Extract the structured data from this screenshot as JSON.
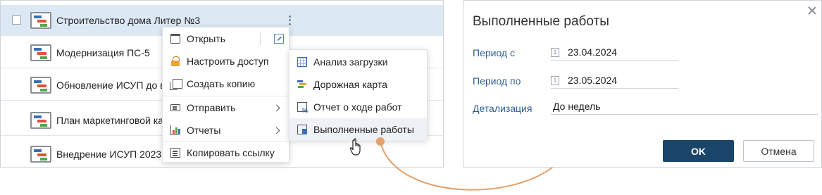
{
  "projects": [
    {
      "label": "Строительство дома Литер №3",
      "selected": true
    },
    {
      "label": "Модернизация ПС-5"
    },
    {
      "label": "Обновление ИСУП до в"
    },
    {
      "label": "План маркетинговой ка"
    },
    {
      "label": "Внедрение ИСУП 2023"
    }
  ],
  "context_menu": {
    "open": "Открыть",
    "access": "Настроить доступ",
    "copy": "Создать копию",
    "send": "Отправить",
    "reports": "Отчеты",
    "copy_link": "Копировать ссылку"
  },
  "reports_submenu": {
    "load_analysis": "Анализ загрузки",
    "roadmap": "Дорожная карта",
    "progress_report": "Отчет о ходе работ",
    "completed_work": "Выполненные работы"
  },
  "dialog": {
    "title": "Выполненные работы",
    "period_from_label": "Период с",
    "period_from_value": "23.04.2024",
    "period_to_label": "Период по",
    "period_to_value": "23.05.2024",
    "detail_label": "Детализация",
    "detail_value": "До недель",
    "calendar_day": "1",
    "ok": "OK",
    "cancel": "Отмена"
  },
  "colors": {
    "accent": "#1b4568",
    "selected_row": "#dde8f5",
    "arrow": "#e2a16a",
    "label_blue": "#2d5f94"
  }
}
